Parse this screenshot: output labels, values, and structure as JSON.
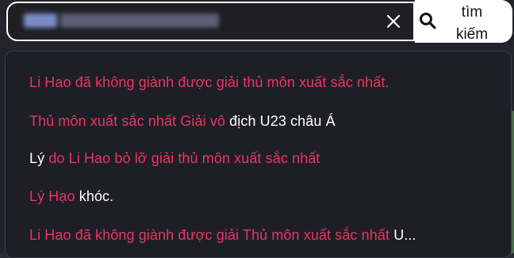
{
  "search": {
    "query": "",
    "button_label": "tìm kiếm",
    "clear_icon": "close-icon",
    "search_icon": "search-icon"
  },
  "suggestions": [
    {
      "highlight": "Li Hao đã không giành được giải thủ môn xuất sắc nhất.",
      "rest": ""
    },
    {
      "highlight": "Thủ môn xuất sắc nhất Giải vô ",
      "rest": "địch U23 châu Á"
    },
    {
      "prefix": "Lý ",
      "highlight": "do Li Hao bỏ lỡ giải thủ môn xuất sắc nhất",
      "rest": ""
    },
    {
      "highlight": "Lý Hạo ",
      "rest": "khóc."
    },
    {
      "highlight": "Li Hao đã không giành được giải Thủ môn xuất sắc nhất ",
      "rest": "U..."
    }
  ],
  "colors": {
    "highlight": "#e8365f",
    "text": "#ffffff",
    "dropdown_bg": "#1e1e26"
  }
}
